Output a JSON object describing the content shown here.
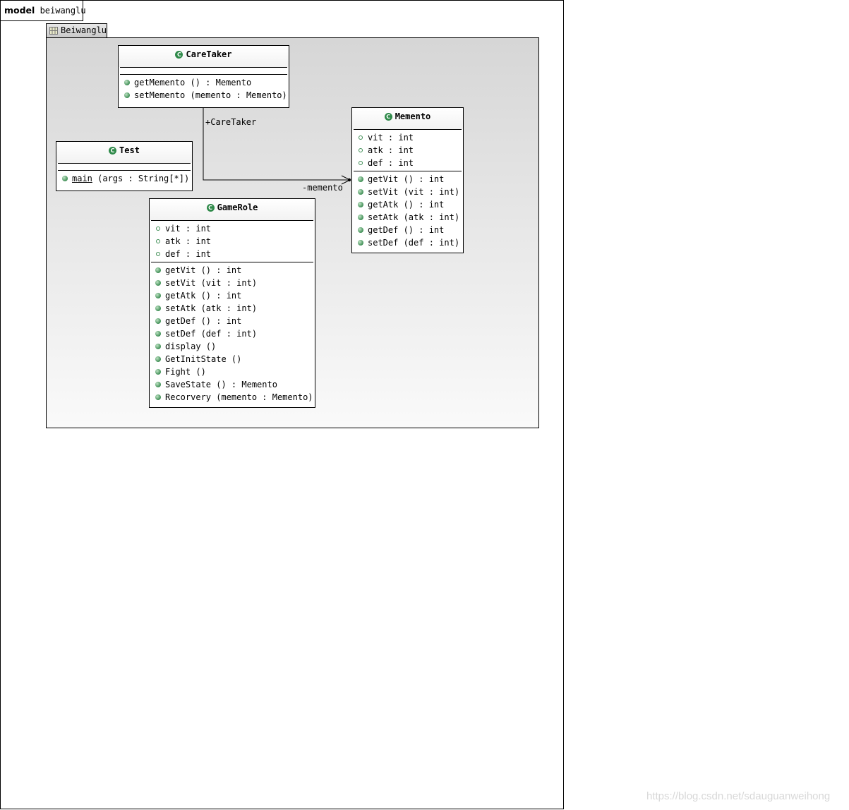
{
  "model": {
    "keyword": "model",
    "name": "beiwanglu"
  },
  "package": {
    "name": "Beiwanglu"
  },
  "classes": {
    "caretaker": {
      "name": "CareTaker",
      "attributes": [],
      "operations": [
        "getMemento () : Memento",
        "setMemento (memento : Memento)"
      ]
    },
    "memento": {
      "name": "Memento",
      "attributes": [
        "vit : int",
        "atk : int",
        "def : int"
      ],
      "operations": [
        "getVit () : int",
        "setVit (vit : int)",
        "getAtk () : int",
        "setAtk (atk : int)",
        "getDef () : int",
        "setDef (def : int)"
      ]
    },
    "test": {
      "name": "Test",
      "attributes": [],
      "operations": [
        {
          "name": "main",
          "rest": " (args : String[*])"
        }
      ]
    },
    "gamerole": {
      "name": "GameRole",
      "attributes": [
        "vit : int",
        "atk : int",
        "def : int"
      ],
      "operations": [
        "getVit () : int",
        "setVit (vit : int)",
        "getAtk () : int",
        "setAtk (atk : int)",
        "getDef () : int",
        "setDef (def : int)",
        "display ()",
        "GetInitState ()",
        "Fight ()",
        "SaveState () : Memento",
        "Recorvery (memento : Memento)"
      ]
    }
  },
  "association": {
    "source_role": "+CareTaker",
    "target_role": "-memento"
  },
  "watermark": "https://blog.csdn.net/sdauguanweihong"
}
